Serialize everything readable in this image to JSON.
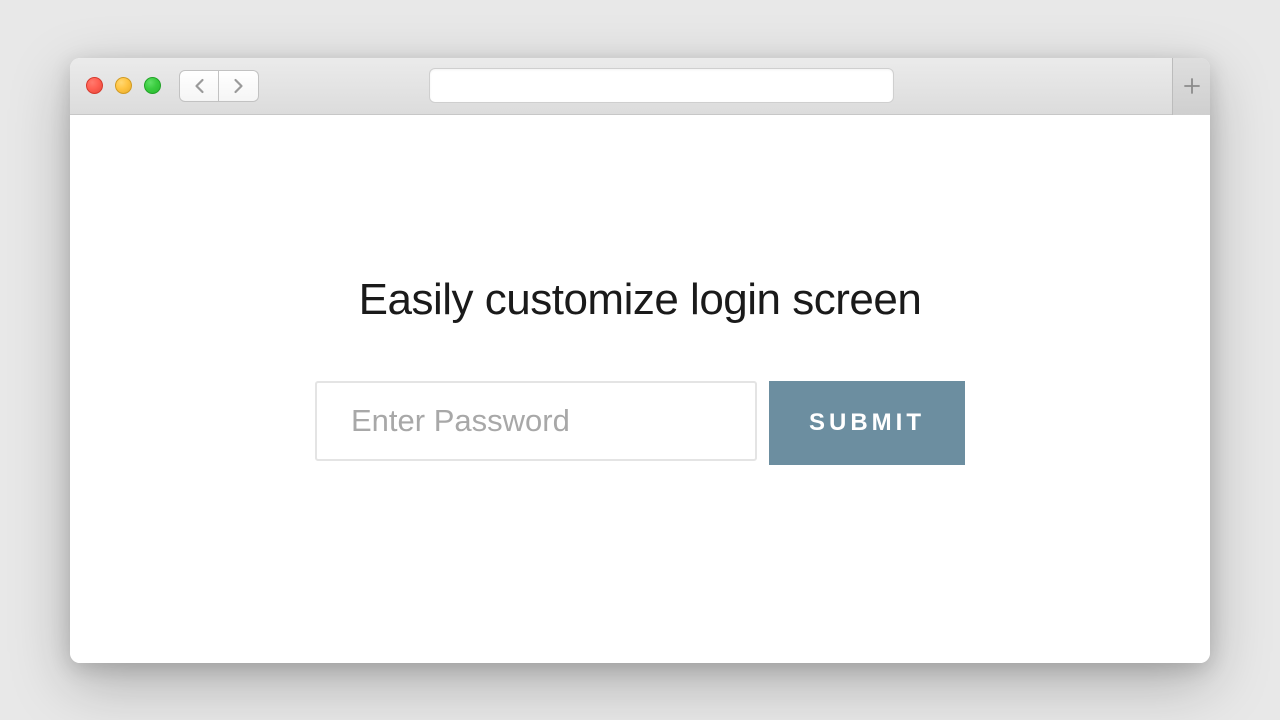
{
  "page": {
    "title": "Easily customize login screen"
  },
  "form": {
    "password_placeholder": "Enter Password",
    "submit_label": "SUBMIT"
  },
  "colors": {
    "submit_bg": "#6c8ea0",
    "traffic_red": "#ff5f52",
    "traffic_yellow": "#ffc443",
    "traffic_green": "#3acc3f"
  }
}
